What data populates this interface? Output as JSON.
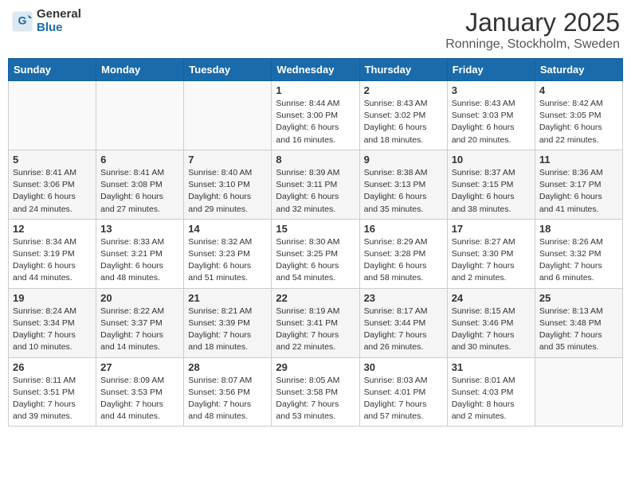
{
  "header": {
    "logo_general": "General",
    "logo_blue": "Blue",
    "month": "January 2025",
    "location": "Ronninge, Stockholm, Sweden"
  },
  "days_of_week": [
    "Sunday",
    "Monday",
    "Tuesday",
    "Wednesday",
    "Thursday",
    "Friday",
    "Saturday"
  ],
  "weeks": [
    {
      "days": [
        {
          "num": "",
          "info": ""
        },
        {
          "num": "",
          "info": ""
        },
        {
          "num": "",
          "info": ""
        },
        {
          "num": "1",
          "info": "Sunrise: 8:44 AM\nSunset: 3:00 PM\nDaylight: 6 hours\nand 16 minutes."
        },
        {
          "num": "2",
          "info": "Sunrise: 8:43 AM\nSunset: 3:02 PM\nDaylight: 6 hours\nand 18 minutes."
        },
        {
          "num": "3",
          "info": "Sunrise: 8:43 AM\nSunset: 3:03 PM\nDaylight: 6 hours\nand 20 minutes."
        },
        {
          "num": "4",
          "info": "Sunrise: 8:42 AM\nSunset: 3:05 PM\nDaylight: 6 hours\nand 22 minutes."
        }
      ]
    },
    {
      "days": [
        {
          "num": "5",
          "info": "Sunrise: 8:41 AM\nSunset: 3:06 PM\nDaylight: 6 hours\nand 24 minutes."
        },
        {
          "num": "6",
          "info": "Sunrise: 8:41 AM\nSunset: 3:08 PM\nDaylight: 6 hours\nand 27 minutes."
        },
        {
          "num": "7",
          "info": "Sunrise: 8:40 AM\nSunset: 3:10 PM\nDaylight: 6 hours\nand 29 minutes."
        },
        {
          "num": "8",
          "info": "Sunrise: 8:39 AM\nSunset: 3:11 PM\nDaylight: 6 hours\nand 32 minutes."
        },
        {
          "num": "9",
          "info": "Sunrise: 8:38 AM\nSunset: 3:13 PM\nDaylight: 6 hours\nand 35 minutes."
        },
        {
          "num": "10",
          "info": "Sunrise: 8:37 AM\nSunset: 3:15 PM\nDaylight: 6 hours\nand 38 minutes."
        },
        {
          "num": "11",
          "info": "Sunrise: 8:36 AM\nSunset: 3:17 PM\nDaylight: 6 hours\nand 41 minutes."
        }
      ]
    },
    {
      "days": [
        {
          "num": "12",
          "info": "Sunrise: 8:34 AM\nSunset: 3:19 PM\nDaylight: 6 hours\nand 44 minutes."
        },
        {
          "num": "13",
          "info": "Sunrise: 8:33 AM\nSunset: 3:21 PM\nDaylight: 6 hours\nand 48 minutes."
        },
        {
          "num": "14",
          "info": "Sunrise: 8:32 AM\nSunset: 3:23 PM\nDaylight: 6 hours\nand 51 minutes."
        },
        {
          "num": "15",
          "info": "Sunrise: 8:30 AM\nSunset: 3:25 PM\nDaylight: 6 hours\nand 54 minutes."
        },
        {
          "num": "16",
          "info": "Sunrise: 8:29 AM\nSunset: 3:28 PM\nDaylight: 6 hours\nand 58 minutes."
        },
        {
          "num": "17",
          "info": "Sunrise: 8:27 AM\nSunset: 3:30 PM\nDaylight: 7 hours\nand 2 minutes."
        },
        {
          "num": "18",
          "info": "Sunrise: 8:26 AM\nSunset: 3:32 PM\nDaylight: 7 hours\nand 6 minutes."
        }
      ]
    },
    {
      "days": [
        {
          "num": "19",
          "info": "Sunrise: 8:24 AM\nSunset: 3:34 PM\nDaylight: 7 hours\nand 10 minutes."
        },
        {
          "num": "20",
          "info": "Sunrise: 8:22 AM\nSunset: 3:37 PM\nDaylight: 7 hours\nand 14 minutes."
        },
        {
          "num": "21",
          "info": "Sunrise: 8:21 AM\nSunset: 3:39 PM\nDaylight: 7 hours\nand 18 minutes."
        },
        {
          "num": "22",
          "info": "Sunrise: 8:19 AM\nSunset: 3:41 PM\nDaylight: 7 hours\nand 22 minutes."
        },
        {
          "num": "23",
          "info": "Sunrise: 8:17 AM\nSunset: 3:44 PM\nDaylight: 7 hours\nand 26 minutes."
        },
        {
          "num": "24",
          "info": "Sunrise: 8:15 AM\nSunset: 3:46 PM\nDaylight: 7 hours\nand 30 minutes."
        },
        {
          "num": "25",
          "info": "Sunrise: 8:13 AM\nSunset: 3:48 PM\nDaylight: 7 hours\nand 35 minutes."
        }
      ]
    },
    {
      "days": [
        {
          "num": "26",
          "info": "Sunrise: 8:11 AM\nSunset: 3:51 PM\nDaylight: 7 hours\nand 39 minutes."
        },
        {
          "num": "27",
          "info": "Sunrise: 8:09 AM\nSunset: 3:53 PM\nDaylight: 7 hours\nand 44 minutes."
        },
        {
          "num": "28",
          "info": "Sunrise: 8:07 AM\nSunset: 3:56 PM\nDaylight: 7 hours\nand 48 minutes."
        },
        {
          "num": "29",
          "info": "Sunrise: 8:05 AM\nSunset: 3:58 PM\nDaylight: 7 hours\nand 53 minutes."
        },
        {
          "num": "30",
          "info": "Sunrise: 8:03 AM\nSunset: 4:01 PM\nDaylight: 7 hours\nand 57 minutes."
        },
        {
          "num": "31",
          "info": "Sunrise: 8:01 AM\nSunset: 4:03 PM\nDaylight: 8 hours\nand 2 minutes."
        },
        {
          "num": "",
          "info": ""
        }
      ]
    }
  ]
}
